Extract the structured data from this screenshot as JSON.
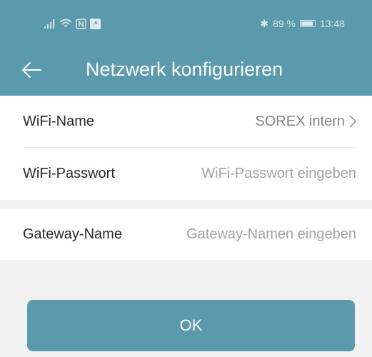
{
  "status_bar": {
    "battery_percent": "89 %",
    "battery_level": 0.89,
    "time": "13:48",
    "icons": [
      "signal-icon",
      "wifi-icon",
      "nfc-icon",
      "notification-icon",
      "bluetooth-icon",
      "battery-icon"
    ]
  },
  "header": {
    "title": "Netzwerk konfigurieren",
    "back_icon": "arrow-left-icon"
  },
  "form": {
    "wifi_name": {
      "label": "WiFi-Name",
      "value": "SOREX intern"
    },
    "wifi_password": {
      "label": "WiFi-Passwort",
      "placeholder": "WiFi-Passwort eingeben"
    },
    "gateway_name": {
      "label": "Gateway-Name",
      "placeholder": "Gateway-Namen eingeben"
    }
  },
  "actions": {
    "ok_label": "OK"
  },
  "colors": {
    "primary": "#5a9aac",
    "background": "#f1f1f1",
    "surface": "#ffffff",
    "label_text": "#2a2a2a",
    "hint_text": "#a3a3a3"
  }
}
